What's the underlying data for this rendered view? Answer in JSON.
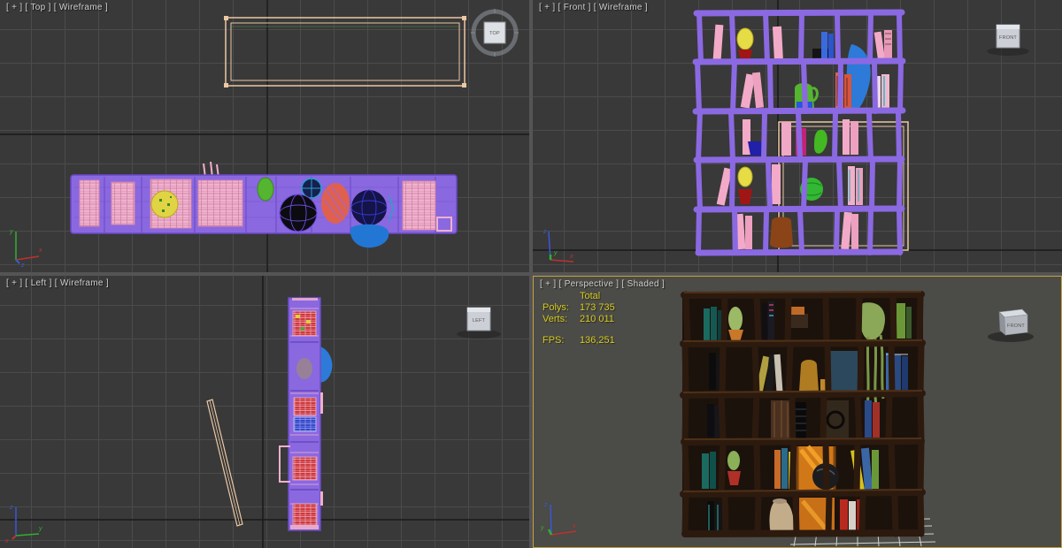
{
  "viewports": {
    "top": {
      "label": "[ + ] [ Top ] [ Wireframe ]",
      "viewcube_label": "TOP"
    },
    "front": {
      "label": "[ + ] [ Front ] [ Wireframe ]",
      "viewcube_label": "FRONT"
    },
    "left": {
      "label": "[ + ] [ Left ] [ Wireframe ]",
      "viewcube_label": "LEFT"
    },
    "perspective": {
      "label": "[ + ] [ Perspective ] [ Shaded ]",
      "viewcube_label": "FRONT",
      "stats": {
        "total_header": "Total",
        "polys_label": "Polys:",
        "polys_value": "173 735",
        "verts_label": "Verts:",
        "verts_value": "210 011",
        "fps_label": "FPS:",
        "fps_value": "136,251"
      }
    }
  },
  "axes": {
    "x": "x",
    "y": "y",
    "z": "z"
  },
  "colors": {
    "viewport_background": "#393939",
    "grid_line": "#4b4b4b",
    "perspective_background": "#4b4b47",
    "active_viewport_border": "#c2a33c",
    "wireframe_purple": "#8b69e3",
    "wireframe_peach": "#ecc8a4",
    "stats_text": "#d6ca1f",
    "shelf_wood": "#2c1a0e"
  }
}
